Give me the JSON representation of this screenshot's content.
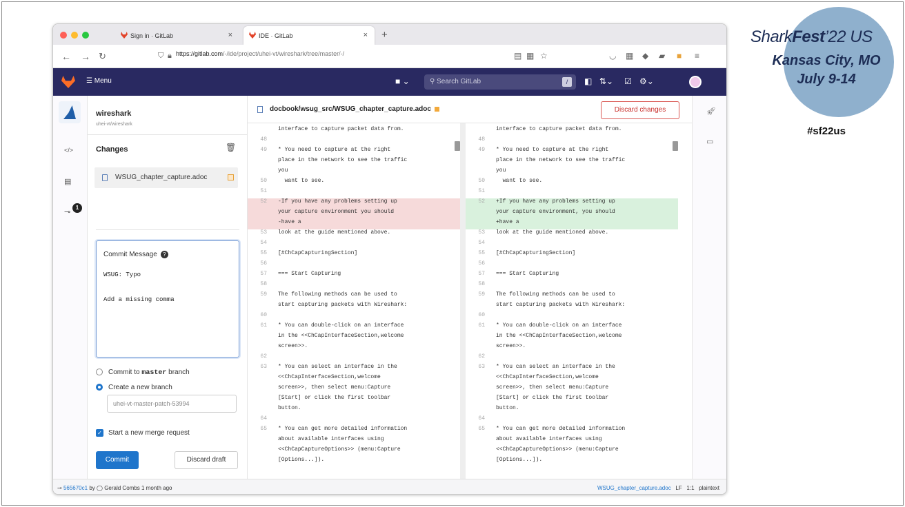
{
  "slide": {
    "title_plain": "Shark",
    "title_bold": "Fest",
    "title_year": "’22 US",
    "location": "Kansas City, MO",
    "dates": "July 9-14",
    "hashtag": "#sf22us"
  },
  "browser": {
    "tabs": [
      {
        "label": "Sign in · GitLab",
        "close": "×"
      },
      {
        "label": "IDE · GitLab",
        "close": "×"
      }
    ],
    "new_tab": "+",
    "url_host": "https://gitlab.com",
    "url_path": "/-/ide/project/uhei-vt/wireshark/tree/master/-/"
  },
  "gitlab": {
    "menu_label": "Menu",
    "search_placeholder": "Search GitLab",
    "search_kbd": "/"
  },
  "project": {
    "name": "wireshark",
    "path": "uhei-vt/wireshark"
  },
  "changes_panel": {
    "title": "Changes",
    "badge_count": "1",
    "file_name": "WSUG_chapter_capture.adoc",
    "commit_message_label": "Commit Message",
    "commit_message_help": "?",
    "commit_message_line1": "WSUG: Typo",
    "commit_message_line2": "Add a missing comma",
    "radio_master_prefix": "Commit to ",
    "radio_master_branch": "master",
    "radio_master_suffix": " branch",
    "radio_new_branch": "Create a new branch",
    "branch_placeholder": "uhei-vt-master-patch-53994",
    "merge_request_label": "Start a new merge request",
    "commit_button": "Commit",
    "discard_draft_button": "Discard draft"
  },
  "diff": {
    "file_path": "docbook/wsug_src/WSUG_chapter_capture.adoc",
    "discard_changes_button": "Discard changes",
    "left_lines": [
      {
        "ln": "",
        "text": "interface to capture packet data from.",
        "type": ""
      },
      {
        "ln": "48",
        "text": "",
        "type": ""
      },
      {
        "ln": "49",
        "text": "* You need to capture at the right",
        "type": ""
      },
      {
        "ln": "",
        "text": "place in the network to see the traffic",
        "type": ""
      },
      {
        "ln": "",
        "text": "you",
        "type": ""
      },
      {
        "ln": "50",
        "text": "  want to see.",
        "type": ""
      },
      {
        "ln": "51",
        "text": "",
        "type": ""
      },
      {
        "ln": "52",
        "text": "-If you have any problems setting up",
        "type": "del"
      },
      {
        "ln": "",
        "text": "your capture environment you should",
        "type": "del"
      },
      {
        "ln": "",
        "text": "-have a",
        "type": "del"
      },
      {
        "ln": "53",
        "text": "look at the guide mentioned above.",
        "type": ""
      },
      {
        "ln": "54",
        "text": "",
        "type": ""
      },
      {
        "ln": "55",
        "text": "[#ChCapCapturingSection]",
        "type": ""
      },
      {
        "ln": "56",
        "text": "",
        "type": ""
      },
      {
        "ln": "57",
        "text": "=== Start Capturing",
        "type": ""
      },
      {
        "ln": "58",
        "text": "",
        "type": ""
      },
      {
        "ln": "59",
        "text": "The following methods can be used to",
        "type": ""
      },
      {
        "ln": "",
        "text": "start capturing packets with Wireshark:",
        "type": ""
      },
      {
        "ln": "60",
        "text": "",
        "type": ""
      },
      {
        "ln": "61",
        "text": "* You can double-click on an interface",
        "type": ""
      },
      {
        "ln": "",
        "text": "in the <<ChCapInterfaceSection,welcome",
        "type": ""
      },
      {
        "ln": "",
        "text": "screen>>.",
        "type": ""
      },
      {
        "ln": "62",
        "text": "",
        "type": ""
      },
      {
        "ln": "63",
        "text": "* You can select an interface in the",
        "type": ""
      },
      {
        "ln": "",
        "text": "<<ChCapInterfaceSection,welcome",
        "type": ""
      },
      {
        "ln": "",
        "text": "screen>>, then select menu:Capture",
        "type": ""
      },
      {
        "ln": "",
        "text": "[Start] or click the first toolbar",
        "type": ""
      },
      {
        "ln": "",
        "text": "button.",
        "type": ""
      },
      {
        "ln": "64",
        "text": "",
        "type": ""
      },
      {
        "ln": "65",
        "text": "* You can get more detailed information",
        "type": ""
      },
      {
        "ln": "",
        "text": "about available interfaces using",
        "type": ""
      },
      {
        "ln": "",
        "text": "<<ChCapCaptureOptions>> (menu:Capture",
        "type": ""
      },
      {
        "ln": "",
        "text": "[Options...]).",
        "type": ""
      }
    ],
    "right_lines": [
      {
        "ln": "",
        "text": "interface to capture packet data from.",
        "type": ""
      },
      {
        "ln": "48",
        "text": "",
        "type": ""
      },
      {
        "ln": "49",
        "text": "* You need to capture at the right",
        "type": ""
      },
      {
        "ln": "",
        "text": "place in the network to see the traffic",
        "type": ""
      },
      {
        "ln": "",
        "text": "you",
        "type": ""
      },
      {
        "ln": "50",
        "text": "  want to see.",
        "type": ""
      },
      {
        "ln": "51",
        "text": "",
        "type": ""
      },
      {
        "ln": "52",
        "text": "+If you have any problems setting up",
        "type": "add"
      },
      {
        "ln": "",
        "text": "your capture environment, you should",
        "type": "add"
      },
      {
        "ln": "",
        "text": "+have a",
        "type": "add"
      },
      {
        "ln": "53",
        "text": "look at the guide mentioned above.",
        "type": ""
      },
      {
        "ln": "54",
        "text": "",
        "type": ""
      },
      {
        "ln": "55",
        "text": "[#ChCapCapturingSection]",
        "type": ""
      },
      {
        "ln": "56",
        "text": "",
        "type": ""
      },
      {
        "ln": "57",
        "text": "=== Start Capturing",
        "type": ""
      },
      {
        "ln": "58",
        "text": "",
        "type": ""
      },
      {
        "ln": "59",
        "text": "The following methods can be used to",
        "type": ""
      },
      {
        "ln": "",
        "text": "start capturing packets with Wireshark:",
        "type": ""
      },
      {
        "ln": "60",
        "text": "",
        "type": ""
      },
      {
        "ln": "61",
        "text": "* You can double-click on an interface",
        "type": ""
      },
      {
        "ln": "",
        "text": "in the <<ChCapInterfaceSection,welcome",
        "type": ""
      },
      {
        "ln": "",
        "text": "screen>>.",
        "type": ""
      },
      {
        "ln": "62",
        "text": "",
        "type": ""
      },
      {
        "ln": "63",
        "text": "* You can select an interface in the",
        "type": ""
      },
      {
        "ln": "",
        "text": "<<ChCapInterfaceSection,welcome",
        "type": ""
      },
      {
        "ln": "",
        "text": "screen>>, then select menu:Capture",
        "type": ""
      },
      {
        "ln": "",
        "text": "[Start] or click the first toolbar",
        "type": ""
      },
      {
        "ln": "",
        "text": "button.",
        "type": ""
      },
      {
        "ln": "64",
        "text": "",
        "type": ""
      },
      {
        "ln": "65",
        "text": "* You can get more detailed information",
        "type": ""
      },
      {
        "ln": "",
        "text": "about available interfaces using",
        "type": ""
      },
      {
        "ln": "",
        "text": "<<ChCapCaptureOptions>> (menu:Capture",
        "type": ""
      },
      {
        "ln": "",
        "text": "[Options...]).",
        "type": ""
      }
    ]
  },
  "statusbar": {
    "commit_sha": "565670c1",
    "commit_by": " by ",
    "author": "Gerald Combs",
    "time": "1 month ago",
    "file": "WSUG_chapter_capture.adoc",
    "eol": "LF",
    "position": "1:1",
    "mode": "plaintext"
  },
  "colors": {
    "gitlab_nav": "#292961",
    "accent_blue": "#1f75cb",
    "deleted_bg": "#f6dada",
    "added_bg": "#d9f1dd",
    "danger": "#c9302c",
    "gitlab_orange": "#fc6d26"
  },
  "icons": [
    "gitlab-logo",
    "hamburger-icon",
    "search-icon",
    "merge-request-icon",
    "todo-icon",
    "help-icon",
    "trash-icon",
    "file-icon",
    "rocket-icon",
    "terminal-icon",
    "code-icon",
    "clipboard-icon",
    "commit-icon"
  ]
}
